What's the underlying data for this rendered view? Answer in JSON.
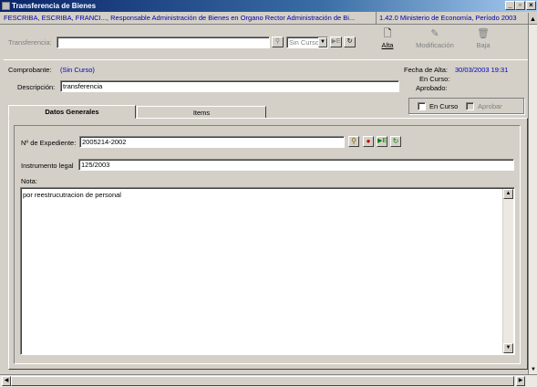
{
  "window": {
    "title": "Transferencia de Bienes",
    "controls": {
      "minimize": "_",
      "maximize": "▫",
      "close": "×"
    }
  },
  "infobar": {
    "left": "FESCRIBA, ESCRIBA, FRANCI..., Responsable Administración de Bienes en Organo Rector Administración de Bi...",
    "right": "1.42.0 Ministerio de Economía, Período 2003"
  },
  "toolbar": {
    "transferencia_label": "Transferencia:",
    "transferencia_value": "",
    "estado_select": "Sin Curso",
    "alta_label": "Alta",
    "modificacion_label": "Modificación",
    "baja_label": "Baja"
  },
  "header": {
    "comprobante_label": "Comprobante:",
    "comprobante_value": "(Sin Curso)",
    "descripcion_label": "Descripción:",
    "descripcion_value": "transferencia",
    "fecha_alta_label": "Fecha de Alta:",
    "fecha_alta_value": "30/03/2003 19:31",
    "en_curso_label": "En Curso:",
    "aprobado_label": "Aprobado:",
    "en_curso_check_label": "En Curso",
    "aprobar_check_label": "Aprobar"
  },
  "tabs": [
    {
      "label": "Datos Generales",
      "active": true
    },
    {
      "label": "Items",
      "active": false
    }
  ],
  "form": {
    "expediente_label": "Nº de Expediente:",
    "expediente_value": "2005214-2002",
    "instrumento_label": "Instrumento legal",
    "instrumento_value": "125/2003",
    "nota_label": "Nota:",
    "nota_value": "por reestrucutracion de personal"
  }
}
